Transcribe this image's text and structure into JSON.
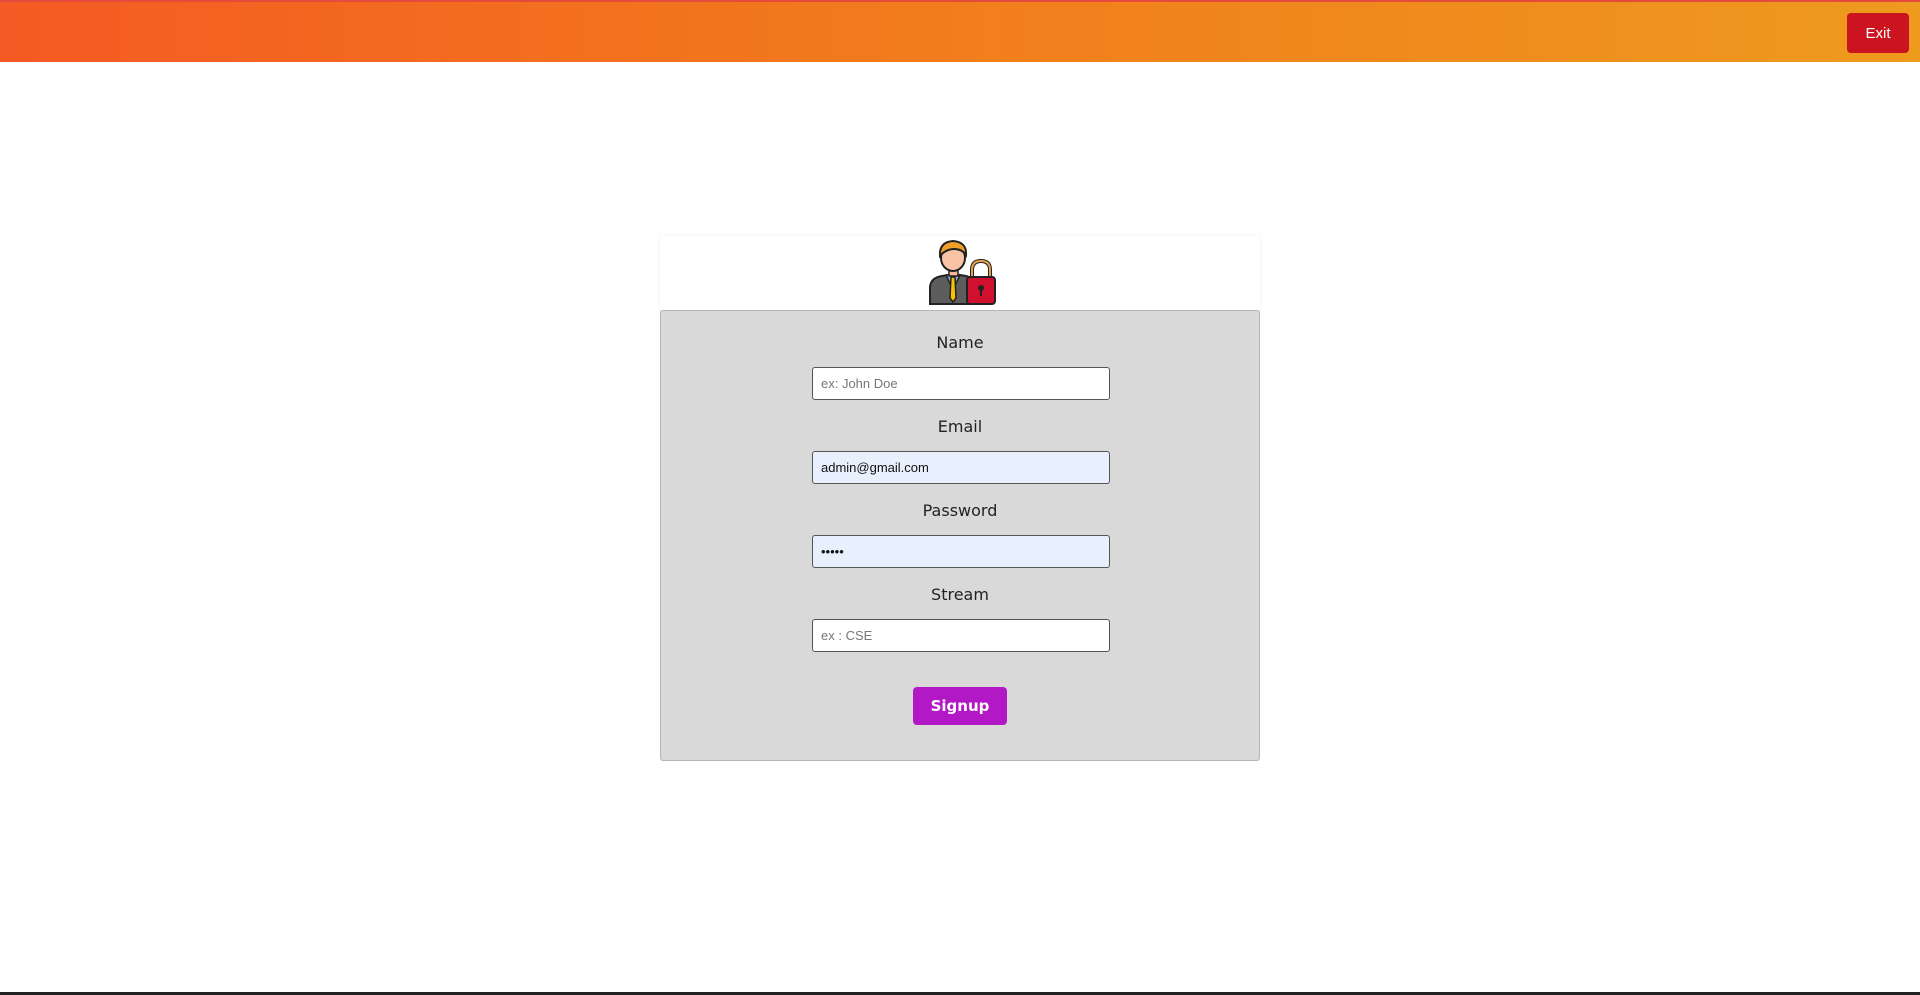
{
  "header": {
    "exit_label": "Exit"
  },
  "card": {
    "avatar_icon": "user-lock-icon"
  },
  "form": {
    "name": {
      "label": "Name",
      "value": "",
      "placeholder": "ex: John Doe"
    },
    "email": {
      "label": "Email",
      "value": "admin@gmail.com",
      "placeholder": ""
    },
    "password": {
      "label": "Password",
      "value": "•••••",
      "placeholder": ""
    },
    "stream": {
      "label": "Stream",
      "value": "",
      "placeholder": "ex : CSE"
    },
    "submit_label": "Signup"
  },
  "colors": {
    "header_gradient_start": "#f45a23",
    "header_gradient_end": "#ee9a1e",
    "exit_button": "#cc1421",
    "signup_button": "#b218c6",
    "form_background": "#d9d9d9",
    "autofill_background": "#e8f0fe"
  }
}
